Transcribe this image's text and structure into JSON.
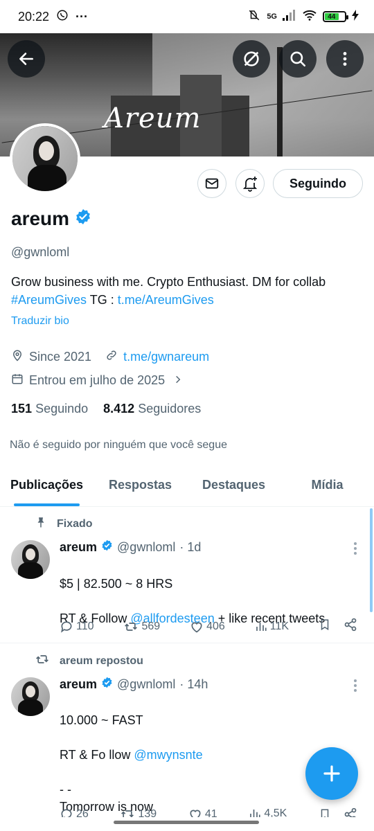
{
  "status": {
    "time": "20:22",
    "battery": "44",
    "network": "5G"
  },
  "profile": {
    "signature": "Areum",
    "name": "areum",
    "handle": "@gwnloml",
    "bio_text": "Grow business with me. Crypto Enthusiast. DM for collab",
    "bio_hashtag": "#AreumGives",
    "bio_tg_label": " TG : ",
    "bio_tg_link": "t.me/AreumGives",
    "translate": "Traduzir bio",
    "since": "Since 2021",
    "website": "t.me/gwnareum",
    "joined": "Entrou em julho de 2025",
    "following_count": "151",
    "following_label": "Seguindo",
    "followers_count": "8.412",
    "followers_label": "Seguidores",
    "followed_note": "Não é seguido por ninguém que você segue",
    "follow_button": "Seguindo"
  },
  "tabs": [
    "Publicações",
    "Respostas",
    "Destaques",
    "Mídia"
  ],
  "tweets": [
    {
      "context": "Fixado",
      "name": "areum",
      "handle": "@gwnloml",
      "time": "· 1d",
      "line1": "$5 | 82.500 ~ 8 HRS",
      "line2_pre": "RT & Follow ",
      "mention": "@allfordesteen",
      "line2_post": " + like recent tweets",
      "replies": "110",
      "retweets": "569",
      "likes": "406",
      "views": "11K"
    },
    {
      "context": "areum repostou",
      "name": "areum",
      "handle": "@gwnloml",
      "time": "· 14h",
      "line1": "10.000 ~ FAST",
      "line2_pre": "RT & Fo llow ",
      "mention": "@mwynsnte",
      "line3": "- -",
      "line4": "Tomorrow is now",
      "replies": "26",
      "retweets": "139",
      "likes": "41",
      "views": "4,5K"
    }
  ],
  "colors": {
    "accent": "#1d9bf0",
    "text": "#0f1419",
    "secondary": "#536471"
  }
}
